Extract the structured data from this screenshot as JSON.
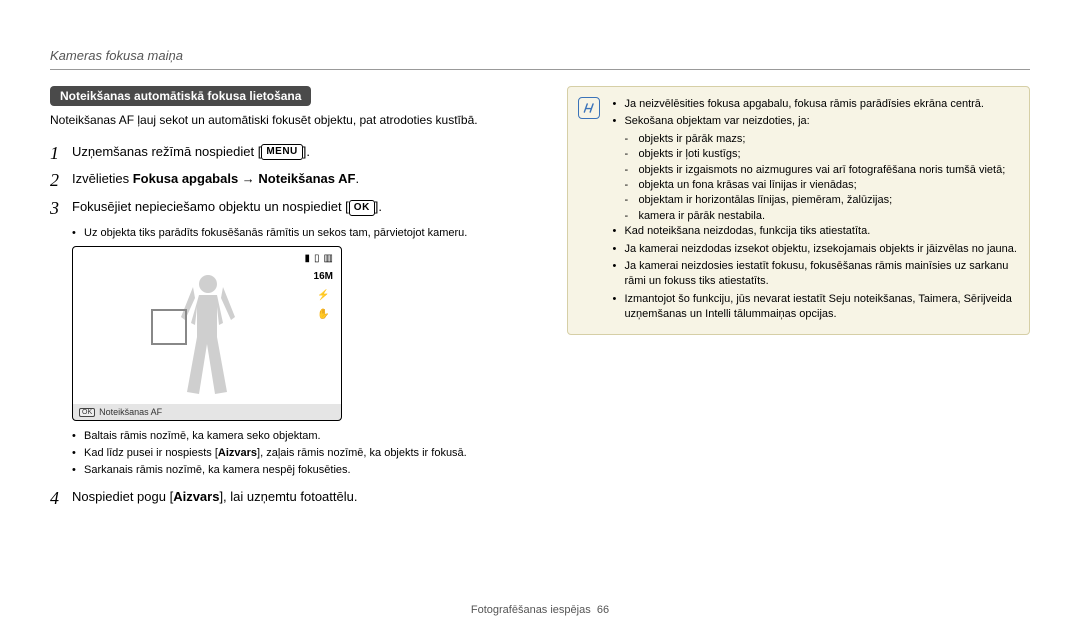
{
  "header": {
    "title": "Kameras fokusa maiņa"
  },
  "section": {
    "chip": "Noteikšanas automātiskā fokusa lietošana"
  },
  "intro": "Noteikšanas AF ļauj sekot un automātiski fokusēt objektu, pat atrodoties kustībā.",
  "steps": {
    "s1": {
      "pre": "Uzņemšanas režīmā nospiediet [",
      "tag": "MENU",
      "post": "]."
    },
    "s2": {
      "pre": "Izvēlieties ",
      "b1": "Fokusa apgabals",
      "arrow": " → ",
      "b2": "Noteikšanas AF",
      "post": "."
    },
    "s3": {
      "pre": "Fokusējiet nepieciešamo objektu un nospiediet [",
      "tag": "OK",
      "post": "]."
    },
    "s3_b1": "Uz objekta tiks parādīts fokusēšanās rāmītis un sekos tam, pārvietojot kameru.",
    "s3_b2": "Baltais rāmis nozīmē, ka kamera seko objektam.",
    "s3_b3_pre": "Kad līdz pusei ir nospiests [",
    "s3_b3_b": "Aizvars",
    "s3_b3_post": "], zaļais rāmis nozīmē, ka objekts ir fokusā.",
    "s3_b4": "Sarkanais rāmis nozīmē, ka kamera nespēj fokusēties.",
    "s4": {
      "pre": "Nospiediet pogu [",
      "b": "Aizvars",
      "post": "], lai uzņemtu fotoattēlu."
    }
  },
  "display": {
    "icon_16m": "16M",
    "icon_flash": "⚡",
    "icon_hand": "✋",
    "bottom_label": "Noteikšanas AF",
    "ok": "OK"
  },
  "note": {
    "l1": "Ja neizvēlēsities fokusa apgabalu, fokusa rāmis parādīsies ekrāna centrā.",
    "l2": "Sekošana objektam var neizdoties, ja:",
    "d1": "objekts ir pārāk mazs;",
    "d2": "objekts ir ļoti kustīgs;",
    "d3": "objekts ir izgaismots no aizmugures vai arī fotografēšana noris tumšā vietā;",
    "d4": "objekta un fona krāsas vai līnijas ir vienādas;",
    "d5": "objektam ir horizontālas līnijas, piemēram, žalūzijas;",
    "d6": "kamera ir pārāk nestabila.",
    "l3": "Kad noteikšana neizdodas, funkcija tiks atiestatīta.",
    "l4": "Ja kamerai neizdodas izsekot objektu, izsekojamais objekts ir jāizvēlas no jauna.",
    "l5": "Ja kamerai neizdosies iestatīt fokusu, fokusēšanas rāmis mainīsies uz sarkanu rāmi un fokuss tiks atiestatīts.",
    "l6": "Izmantojot šo funkciju, jūs nevarat iestatīt Seju noteikšanas, Taimera, Sērijveida uzņemšanas un Intelli tālummaiņas opcijas."
  },
  "footer": {
    "section": "Fotografēšanas iespējas",
    "page": "66"
  }
}
